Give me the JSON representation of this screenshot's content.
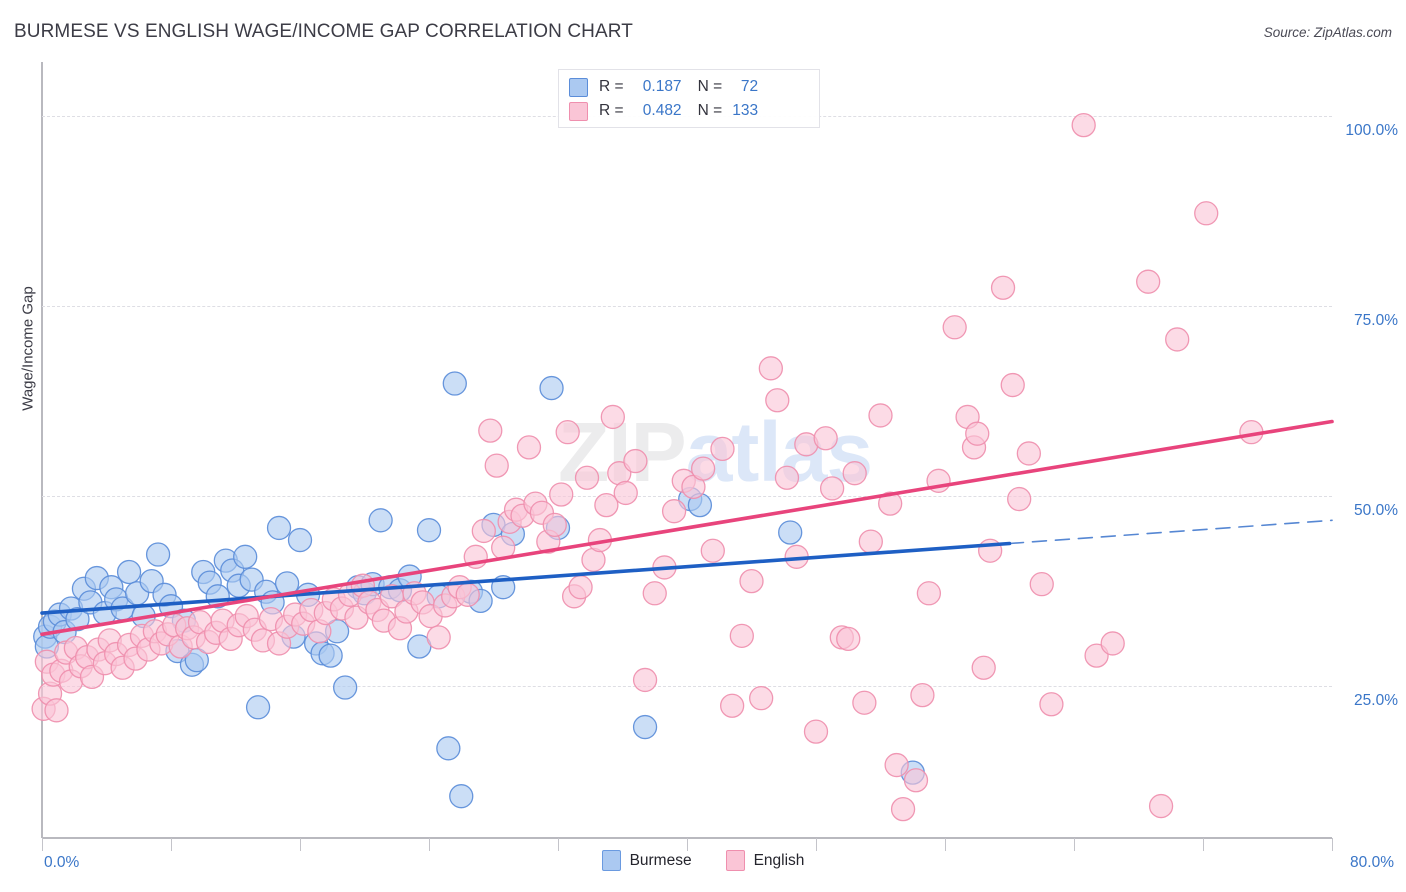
{
  "header": {
    "title": "BURMESE VS ENGLISH WAGE/INCOME GAP CORRELATION CHART",
    "source": "Source: ZipAtlas.com"
  },
  "watermark": {
    "part1": "ZIP",
    "part2": "atlas"
  },
  "stat_legend": {
    "rows": [
      {
        "series": "Burmese",
        "r_label": "R =",
        "r_value": "0.187",
        "n_label": "N =",
        "n_value": "72",
        "color": "#abc9f1",
        "border": "#5b8dd9"
      },
      {
        "series": "English",
        "r_label": "R =",
        "r_value": "0.482",
        "n_label": "N =",
        "n_value": "133",
        "color": "#fac5d6",
        "border": "#ef8fae"
      }
    ]
  },
  "bottom_legend": {
    "items": [
      {
        "label": "Burmese",
        "color": "#abc9f1",
        "border": "#6a9ae0"
      },
      {
        "label": "English",
        "color": "#fac5d6",
        "border": "#ef8fae"
      }
    ]
  },
  "chart_data": {
    "type": "scatter",
    "title": "BURMESE VS ENGLISH WAGE/INCOME GAP CORRELATION CHART",
    "xlabel": "",
    "ylabel": "Wage/Income Gap",
    "xlim": [
      0,
      80
    ],
    "ylim": [
      5,
      105
    ],
    "grid": true,
    "x_tick_labels": [
      "0.0%",
      "80.0%"
    ],
    "y_tick_labels": [
      "100.0%",
      "75.0%",
      "50.0%",
      "25.0%"
    ],
    "y_ticks": [
      100,
      75,
      50,
      25
    ],
    "legend_position": "bottom-center",
    "series": [
      {
        "name": "Burmese",
        "color": "#abc9f1",
        "border": "#5b8dd9",
        "r": 0.187,
        "n": 72,
        "trend": {
          "x0": 0,
          "y0": 34.6,
          "x1": 80,
          "y1": 46.8,
          "solid_to_x": 60,
          "dashed_after": true,
          "color": "#1e5fc4"
        },
        "points": [
          [
            0.2,
            31.5
          ],
          [
            0.3,
            30.2
          ],
          [
            0.5,
            32.8
          ],
          [
            0.8,
            33.5
          ],
          [
            1.1,
            34.4
          ],
          [
            1.4,
            32.1
          ],
          [
            1.8,
            35.2
          ],
          [
            2.2,
            33.8
          ],
          [
            2.6,
            37.8
          ],
          [
            3.0,
            36.0
          ],
          [
            3.4,
            39.2
          ],
          [
            3.9,
            34.6
          ],
          [
            4.3,
            38.0
          ],
          [
            4.6,
            36.4
          ],
          [
            5.0,
            35.2
          ],
          [
            5.4,
            40.0
          ],
          [
            5.9,
            37.2
          ],
          [
            6.3,
            34.2
          ],
          [
            6.8,
            38.8
          ],
          [
            7.2,
            42.3
          ],
          [
            7.6,
            37.0
          ],
          [
            8.0,
            35.5
          ],
          [
            8.4,
            29.6
          ],
          [
            8.8,
            33.6
          ],
          [
            9.3,
            27.8
          ],
          [
            9.6,
            28.4
          ],
          [
            10.0,
            40.0
          ],
          [
            10.4,
            38.6
          ],
          [
            10.9,
            36.8
          ],
          [
            11.4,
            41.5
          ],
          [
            11.8,
            40.2
          ],
          [
            12.2,
            38.2
          ],
          [
            12.6,
            42.0
          ],
          [
            13.0,
            39.0
          ],
          [
            13.4,
            22.2
          ],
          [
            13.9,
            37.4
          ],
          [
            14.3,
            36.0
          ],
          [
            14.7,
            45.8
          ],
          [
            15.2,
            38.5
          ],
          [
            15.6,
            31.5
          ],
          [
            16.0,
            44.2
          ],
          [
            16.5,
            37.0
          ],
          [
            17.0,
            30.6
          ],
          [
            17.4,
            29.3
          ],
          [
            17.9,
            29.0
          ],
          [
            18.3,
            32.2
          ],
          [
            18.8,
            24.8
          ],
          [
            19.6,
            38.0
          ],
          [
            20.0,
            37.2
          ],
          [
            20.5,
            38.4
          ],
          [
            21.0,
            46.8
          ],
          [
            21.6,
            38.0
          ],
          [
            22.2,
            37.6
          ],
          [
            22.8,
            39.4
          ],
          [
            23.4,
            30.2
          ],
          [
            24.0,
            45.5
          ],
          [
            24.6,
            36.8
          ],
          [
            25.2,
            16.8
          ],
          [
            25.6,
            64.8
          ],
          [
            26.0,
            10.5
          ],
          [
            26.6,
            37.4
          ],
          [
            27.2,
            36.2
          ],
          [
            28.0,
            46.2
          ],
          [
            28.6,
            38.0
          ],
          [
            29.2,
            45.0
          ],
          [
            31.6,
            64.2
          ],
          [
            32.0,
            45.8
          ],
          [
            37.4,
            19.6
          ],
          [
            40.2,
            49.6
          ],
          [
            40.8,
            48.8
          ],
          [
            46.4,
            45.2
          ],
          [
            54.0,
            13.6
          ]
        ]
      },
      {
        "name": "English",
        "color": "#fac5d6",
        "border": "#ef8fae",
        "r": 0.482,
        "n": 133,
        "trend": {
          "x0": 0,
          "y0": 31.8,
          "x1": 80,
          "y1": 59.8,
          "solid_to_x": 80,
          "dashed_after": false,
          "color": "#e8447c"
        },
        "points": [
          [
            0.1,
            22.0
          ],
          [
            0.3,
            28.2
          ],
          [
            0.5,
            24.0
          ],
          [
            0.7,
            26.5
          ],
          [
            0.9,
            21.8
          ],
          [
            1.2,
            27.0
          ],
          [
            1.5,
            29.4
          ],
          [
            1.8,
            25.6
          ],
          [
            2.1,
            30.0
          ],
          [
            2.4,
            27.6
          ],
          [
            2.8,
            28.8
          ],
          [
            3.1,
            26.2
          ],
          [
            3.5,
            29.8
          ],
          [
            3.9,
            28.0
          ],
          [
            4.2,
            31.0
          ],
          [
            4.6,
            29.2
          ],
          [
            5.0,
            27.4
          ],
          [
            5.4,
            30.4
          ],
          [
            5.8,
            28.6
          ],
          [
            6.2,
            31.6
          ],
          [
            6.6,
            29.8
          ],
          [
            7.0,
            32.2
          ],
          [
            7.4,
            30.6
          ],
          [
            7.8,
            31.8
          ],
          [
            8.2,
            33.0
          ],
          [
            8.6,
            30.2
          ],
          [
            9.0,
            32.6
          ],
          [
            9.4,
            31.4
          ],
          [
            9.8,
            33.4
          ],
          [
            10.3,
            30.8
          ],
          [
            10.8,
            32.0
          ],
          [
            11.2,
            33.6
          ],
          [
            11.7,
            31.2
          ],
          [
            12.2,
            33.0
          ],
          [
            12.7,
            34.2
          ],
          [
            13.2,
            32.4
          ],
          [
            13.7,
            31.0
          ],
          [
            14.2,
            33.8
          ],
          [
            14.7,
            30.6
          ],
          [
            15.2,
            32.8
          ],
          [
            15.7,
            34.4
          ],
          [
            16.2,
            33.2
          ],
          [
            16.7,
            35.0
          ],
          [
            17.2,
            32.2
          ],
          [
            17.6,
            34.6
          ],
          [
            18.1,
            36.4
          ],
          [
            18.6,
            35.2
          ],
          [
            19.1,
            37.0
          ],
          [
            19.5,
            34.0
          ],
          [
            19.9,
            38.2
          ],
          [
            20.3,
            36.0
          ],
          [
            20.8,
            35.0
          ],
          [
            21.2,
            33.6
          ],
          [
            21.7,
            36.8
          ],
          [
            22.2,
            32.6
          ],
          [
            22.6,
            34.8
          ],
          [
            23.1,
            37.2
          ],
          [
            23.6,
            36.0
          ],
          [
            24.1,
            34.2
          ],
          [
            24.6,
            31.4
          ],
          [
            25.0,
            35.6
          ],
          [
            25.5,
            36.8
          ],
          [
            25.9,
            38.0
          ],
          [
            26.4,
            37.0
          ],
          [
            26.9,
            42.0
          ],
          [
            27.4,
            45.4
          ],
          [
            27.8,
            58.6
          ],
          [
            28.2,
            54.0
          ],
          [
            28.6,
            43.2
          ],
          [
            29.0,
            46.6
          ],
          [
            29.4,
            48.2
          ],
          [
            29.8,
            47.4
          ],
          [
            30.2,
            56.4
          ],
          [
            30.6,
            49.0
          ],
          [
            31.0,
            47.8
          ],
          [
            31.4,
            44.0
          ],
          [
            31.8,
            46.2
          ],
          [
            32.2,
            50.2
          ],
          [
            32.6,
            58.4
          ],
          [
            33.0,
            36.8
          ],
          [
            33.4,
            38.0
          ],
          [
            33.8,
            52.4
          ],
          [
            34.2,
            41.6
          ],
          [
            34.6,
            44.2
          ],
          [
            35.0,
            48.8
          ],
          [
            35.4,
            60.4
          ],
          [
            35.8,
            53.0
          ],
          [
            36.2,
            50.4
          ],
          [
            36.8,
            54.6
          ],
          [
            37.4,
            25.8
          ],
          [
            38.0,
            37.2
          ],
          [
            38.6,
            40.6
          ],
          [
            39.2,
            48.0
          ],
          [
            39.8,
            52.0
          ],
          [
            40.4,
            51.2
          ],
          [
            41.0,
            53.6
          ],
          [
            41.6,
            42.8
          ],
          [
            42.2,
            56.2
          ],
          [
            42.8,
            22.4
          ],
          [
            43.4,
            31.6
          ],
          [
            44.0,
            38.8
          ],
          [
            44.6,
            23.4
          ],
          [
            45.2,
            66.8
          ],
          [
            45.6,
            62.6
          ],
          [
            46.2,
            52.4
          ],
          [
            46.8,
            42.0
          ],
          [
            47.4,
            56.8
          ],
          [
            48.0,
            19.0
          ],
          [
            48.6,
            57.6
          ],
          [
            49.0,
            51.0
          ],
          [
            49.6,
            31.4
          ],
          [
            50.0,
            31.2
          ],
          [
            50.4,
            53.0
          ],
          [
            51.0,
            22.8
          ],
          [
            51.4,
            44.0
          ],
          [
            52.0,
            60.6
          ],
          [
            52.6,
            49.0
          ],
          [
            53.0,
            14.6
          ],
          [
            53.4,
            8.8
          ],
          [
            54.2,
            12.6
          ],
          [
            54.6,
            23.8
          ],
          [
            55.0,
            37.2
          ],
          [
            55.6,
            52.0
          ],
          [
            56.6,
            72.2
          ],
          [
            57.4,
            60.4
          ],
          [
            57.8,
            56.4
          ],
          [
            58.0,
            58.2
          ],
          [
            58.4,
            27.4
          ],
          [
            58.8,
            42.8
          ],
          [
            59.6,
            77.4
          ],
          [
            60.2,
            64.6
          ],
          [
            60.6,
            49.6
          ],
          [
            61.2,
            55.6
          ],
          [
            62.0,
            38.4
          ],
          [
            62.6,
            22.6
          ],
          [
            64.6,
            98.8
          ],
          [
            65.4,
            29.0
          ],
          [
            66.4,
            30.6
          ],
          [
            68.6,
            78.2
          ],
          [
            69.4,
            9.2
          ],
          [
            70.4,
            70.6
          ],
          [
            72.2,
            87.2
          ],
          [
            75.0,
            58.4
          ]
        ]
      }
    ]
  }
}
